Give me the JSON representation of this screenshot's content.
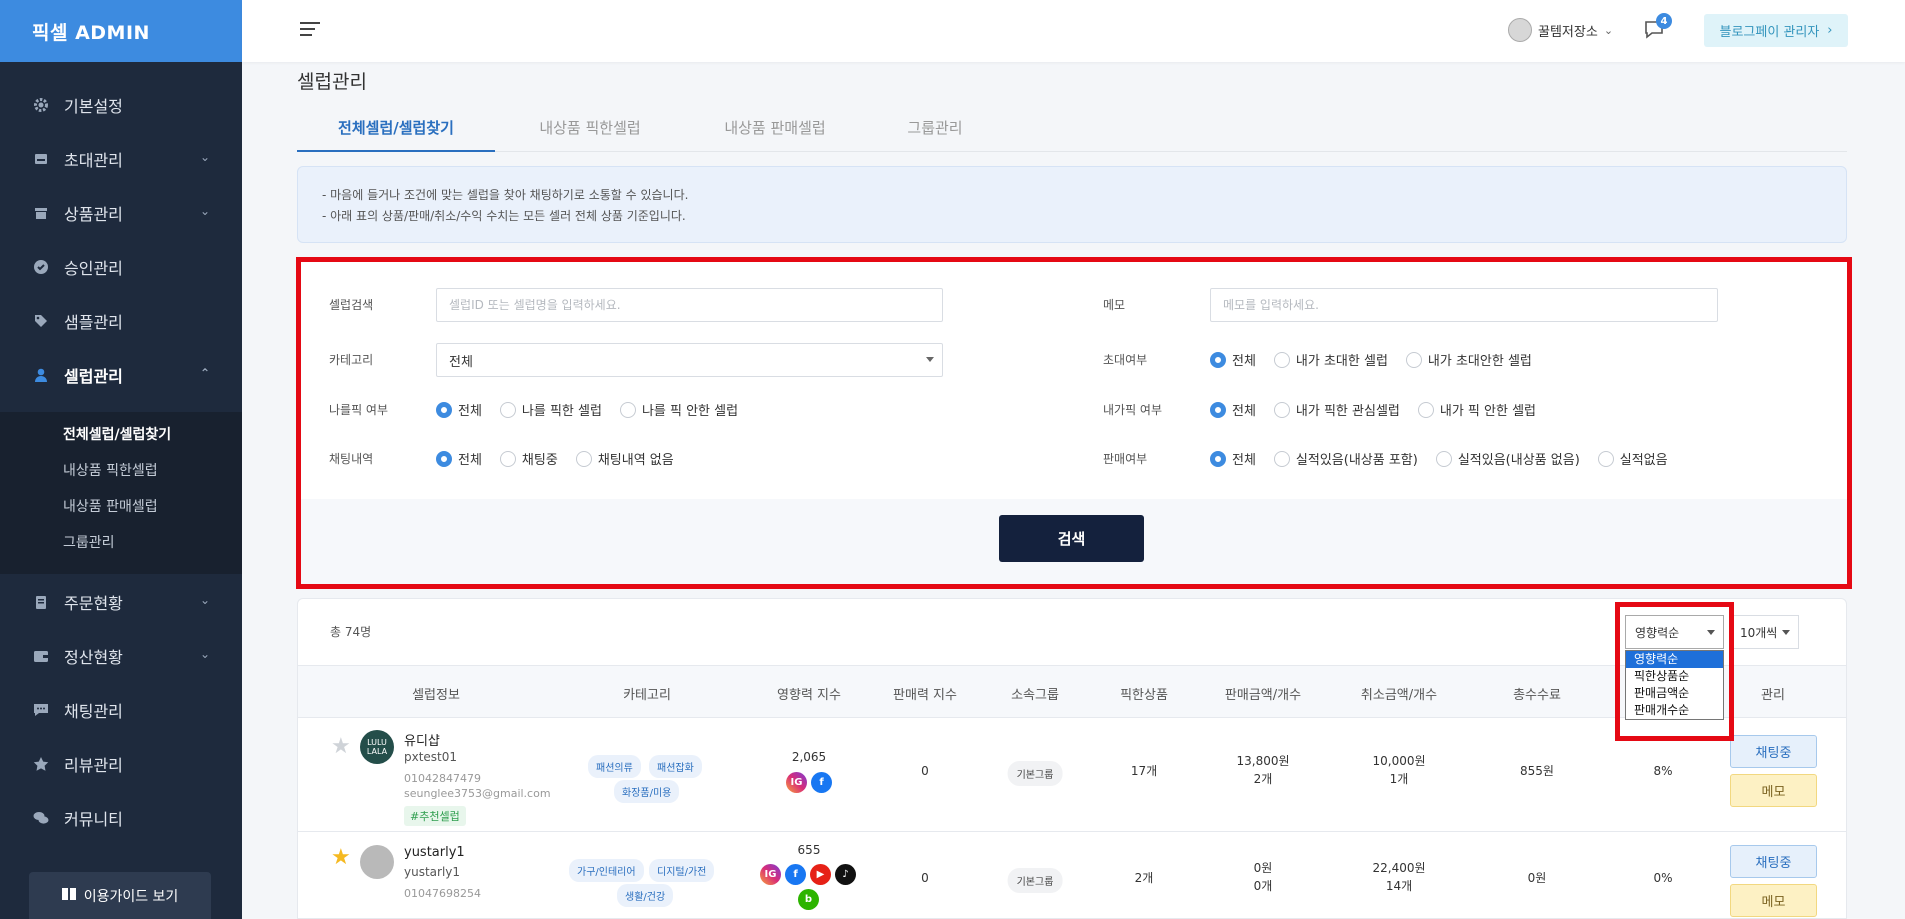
{
  "brand": {
    "logo": "픽셀 ADMIN"
  },
  "sidebar": {
    "items": [
      {
        "label": "기본설정",
        "icon": "gear-icon"
      },
      {
        "label": "초대관리",
        "icon": "inbox-icon"
      },
      {
        "label": "상품관리",
        "icon": "box-icon"
      },
      {
        "label": "승인관리",
        "icon": "badge-check-icon"
      },
      {
        "label": "샘플관리",
        "icon": "tag-icon"
      },
      {
        "label": "셀럽관리",
        "icon": "user-icon"
      },
      {
        "label": "주문현황",
        "icon": "clipboard-icon"
      },
      {
        "label": "정산현황",
        "icon": "wallet-icon"
      },
      {
        "label": "채팅관리",
        "icon": "chat-icon"
      },
      {
        "label": "리뷰관리",
        "icon": "star-icon"
      },
      {
        "label": "커뮤니티",
        "icon": "comments-icon"
      }
    ],
    "sub_items": [
      "전체셀럽/셀럽찾기",
      "내상품 픽한셀럽",
      "내상품 판매셀럽",
      "그룹관리"
    ],
    "guide_button": "이용가이드 보기"
  },
  "header": {
    "user_name": "꿀템저장소",
    "notification_count": "4",
    "admin_button": "블로그페이 관리자"
  },
  "page": {
    "title": "셀럽관리",
    "tabs": [
      "전체셀럽/셀럽찾기",
      "내상품 픽한셀럽",
      "내상품 판매셀럽",
      "그룹관리"
    ],
    "notice": [
      "-  마음에 들거나 조건에 맞는 셀럽을 찾아 채팅하기로 소통할 수 있습니다.",
      "-  아래 표의 상품/판매/취소/수익 수치는 모든 셀러 전체 상품 기준입니다."
    ]
  },
  "filters": {
    "celeb_search": {
      "label": "셀럽검색",
      "placeholder": "셀럽ID 또는 셀럽명을 입력하세요."
    },
    "memo": {
      "label": "메모",
      "placeholder": "메모를 입력하세요."
    },
    "category": {
      "label": "카테고리",
      "value": "전체"
    },
    "invite": {
      "label": "초대여부",
      "options": [
        "전체",
        "내가 초대한 셀럽",
        "내가 초대안한 셀럽"
      ]
    },
    "picked_me": {
      "label": "나를픽 여부",
      "options": [
        "전체",
        "나를 픽한 셀럽",
        "나를 픽 안한 셀럽"
      ]
    },
    "my_pick": {
      "label": "내가픽 여부",
      "options": [
        "전체",
        "내가 픽한 관심셀럽",
        "내가 픽 안한 셀럽"
      ]
    },
    "chat": {
      "label": "채팅내역",
      "options": [
        "전체",
        "채팅중",
        "채팅내역 없음"
      ]
    },
    "sales": {
      "label": "판매여부",
      "options": [
        "전체",
        "실적있음(내상품 포함)",
        "실적있음(내상품 없음)",
        "실적없음"
      ]
    },
    "search_button": "검색"
  },
  "results": {
    "total": "총 74명",
    "sort": {
      "value": "영향력순",
      "options": [
        "영향력순",
        "픽한상품순",
        "판매금액순",
        "판매개수순"
      ]
    },
    "per_page": "10개씩",
    "columns": [
      "셀럽정보",
      "카테고리",
      "영향력 지수",
      "판매력 지수",
      "소속그룹",
      "픽한상품",
      "판매금액/개수",
      "취소금액/개수",
      "총수수료",
      "관리"
    ],
    "rows": [
      {
        "starred": false,
        "avatar_text": "LULU LALA",
        "name": "유디샵",
        "id": "pxtest01",
        "phone": "01042847479",
        "email": "seunglee3753@gmail.com",
        "tag": "#추천셀럽",
        "categories": [
          "패션의류",
          "패션잡화",
          "화장품/미용"
        ],
        "influence": "2,065",
        "sales_power": "0",
        "group": "기본그룹",
        "picked": "17개",
        "sales_amount": "13,800원",
        "sales_count": "2개",
        "cancel_amount": "10,000원",
        "cancel_count": "1개",
        "fee": "855원",
        "rate": "8%",
        "chat_button": "채팅중",
        "memo_button": "메모"
      },
      {
        "starred": true,
        "avatar_text": "",
        "name": "yustarly1",
        "id": "yustarly1",
        "phone": "01047698254",
        "email": "",
        "tag": "",
        "categories": [
          "가구/인테리어",
          "디지털/가전",
          "생활/건강"
        ],
        "influence": "655",
        "sales_power": "0",
        "group": "기본그룹",
        "picked": "2개",
        "sales_amount": "0원",
        "sales_count": "0개",
        "cancel_amount": "22,400원",
        "cancel_count": "14개",
        "fee": "0원",
        "rate": "0%",
        "chat_button": "채팅중",
        "memo_button": "메모"
      }
    ]
  },
  "colors": {
    "accent": "#3d8be0",
    "sidebar": "#1e2a3d",
    "highlight": "#e50914",
    "search_button": "#14213d"
  }
}
